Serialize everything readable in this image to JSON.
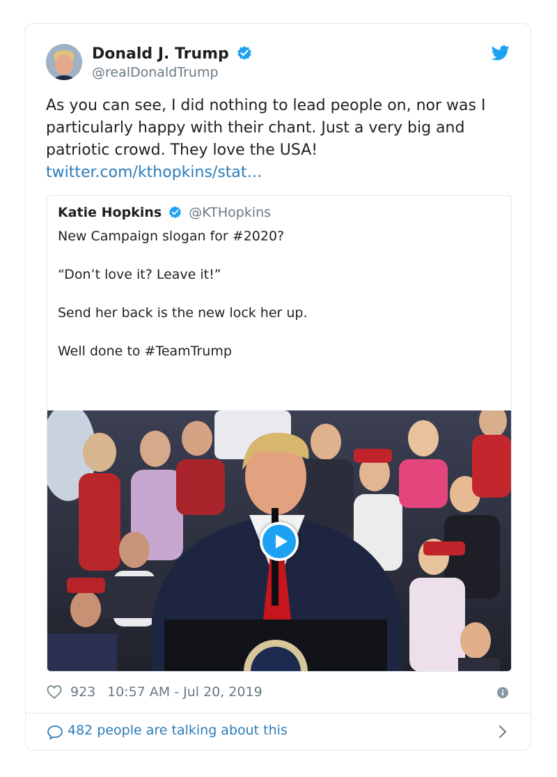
{
  "tweet": {
    "author_name": "Donald J. Trump",
    "author_handle": "@realDonaldTrump",
    "text": "As you can see, I did nothing to lead people on, nor was I particularly happy with their chant. Just a very big and patriotic crowd. They love the USA!",
    "link": "twitter.com/kthopkins/stat…",
    "likes": "923",
    "timestamp": "10:57 AM - Jul 20, 2019"
  },
  "quote": {
    "author_name": "Katie Hopkins",
    "author_handle": "@KTHopkins",
    "lines": [
      "New Campaign slogan  for #2020?",
      "“Don’t love it? Leave it!”",
      "Send her back is the new lock her up.",
      "Well done to #TeamTrump"
    ]
  },
  "conversation": {
    "label": "482 people are talking about this"
  },
  "icons": {
    "verified": "verified-badge-icon",
    "brand": "twitter-bird-icon",
    "like": "heart-icon",
    "info": "info-icon",
    "reply": "speech-bubble-icon",
    "more": "chevron-right-icon",
    "play": "play-icon"
  },
  "colors": {
    "twitter_blue": "#1da1f2",
    "link": "#2b7bb9",
    "muted": "#697882",
    "border": "#e1e8ed"
  }
}
